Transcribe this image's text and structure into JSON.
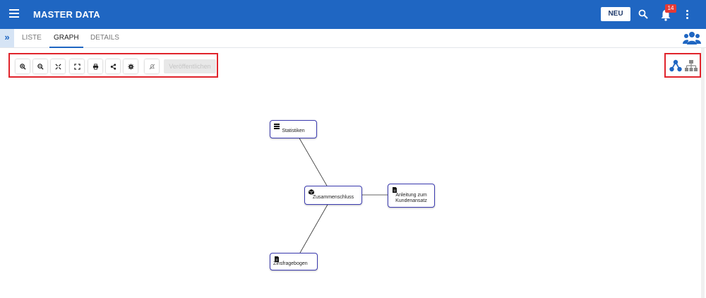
{
  "header": {
    "title": "MASTER DATA",
    "new_label": "NEU",
    "notification_count": "14",
    "menu_icon": "hamburger-menu-icon",
    "search_icon": "search-icon",
    "bell_icon": "bell-icon",
    "more_icon": "kebab-icon",
    "background": "#1f66c2"
  },
  "tabs": [
    {
      "label": "LISTE",
      "active": false
    },
    {
      "label": "GRAPH",
      "active": true
    },
    {
      "label": "DETAILS",
      "active": false
    }
  ],
  "toolbar": {
    "buttons": [
      "zoom-in-icon",
      "zoom-out-icon",
      "fit-icon",
      "fullscreen-icon",
      "print-icon",
      "share-icon",
      "settings-icon",
      "hide-icon"
    ],
    "publish_label": "Veröffentlichen"
  },
  "layout_buttons": [
    "radial-layout-icon",
    "hierarchy-layout-icon"
  ],
  "graph": {
    "nodes": [
      {
        "id": "statistiken",
        "label": "Statistiken",
        "icon": "list-icon"
      },
      {
        "id": "zusammenschluss",
        "label": "Zusammenschluss",
        "icon": "cube-icon"
      },
      {
        "id": "anleitung",
        "label": "Anleitung zum Kundenansatz",
        "icon": "document-icon"
      },
      {
        "id": "zinsfragebogen",
        "label": "Zinsfragebogen",
        "icon": "document-icon"
      }
    ],
    "edges": [
      [
        "statistiken",
        "zusammenschluss"
      ],
      [
        "zusammenschluss",
        "anleitung"
      ],
      [
        "zusammenschluss",
        "zinsfragebogen"
      ]
    ]
  },
  "colors": {
    "accent": "#1f66c2",
    "highlight": "#e0242c",
    "node_border": "#3b3bb0"
  }
}
